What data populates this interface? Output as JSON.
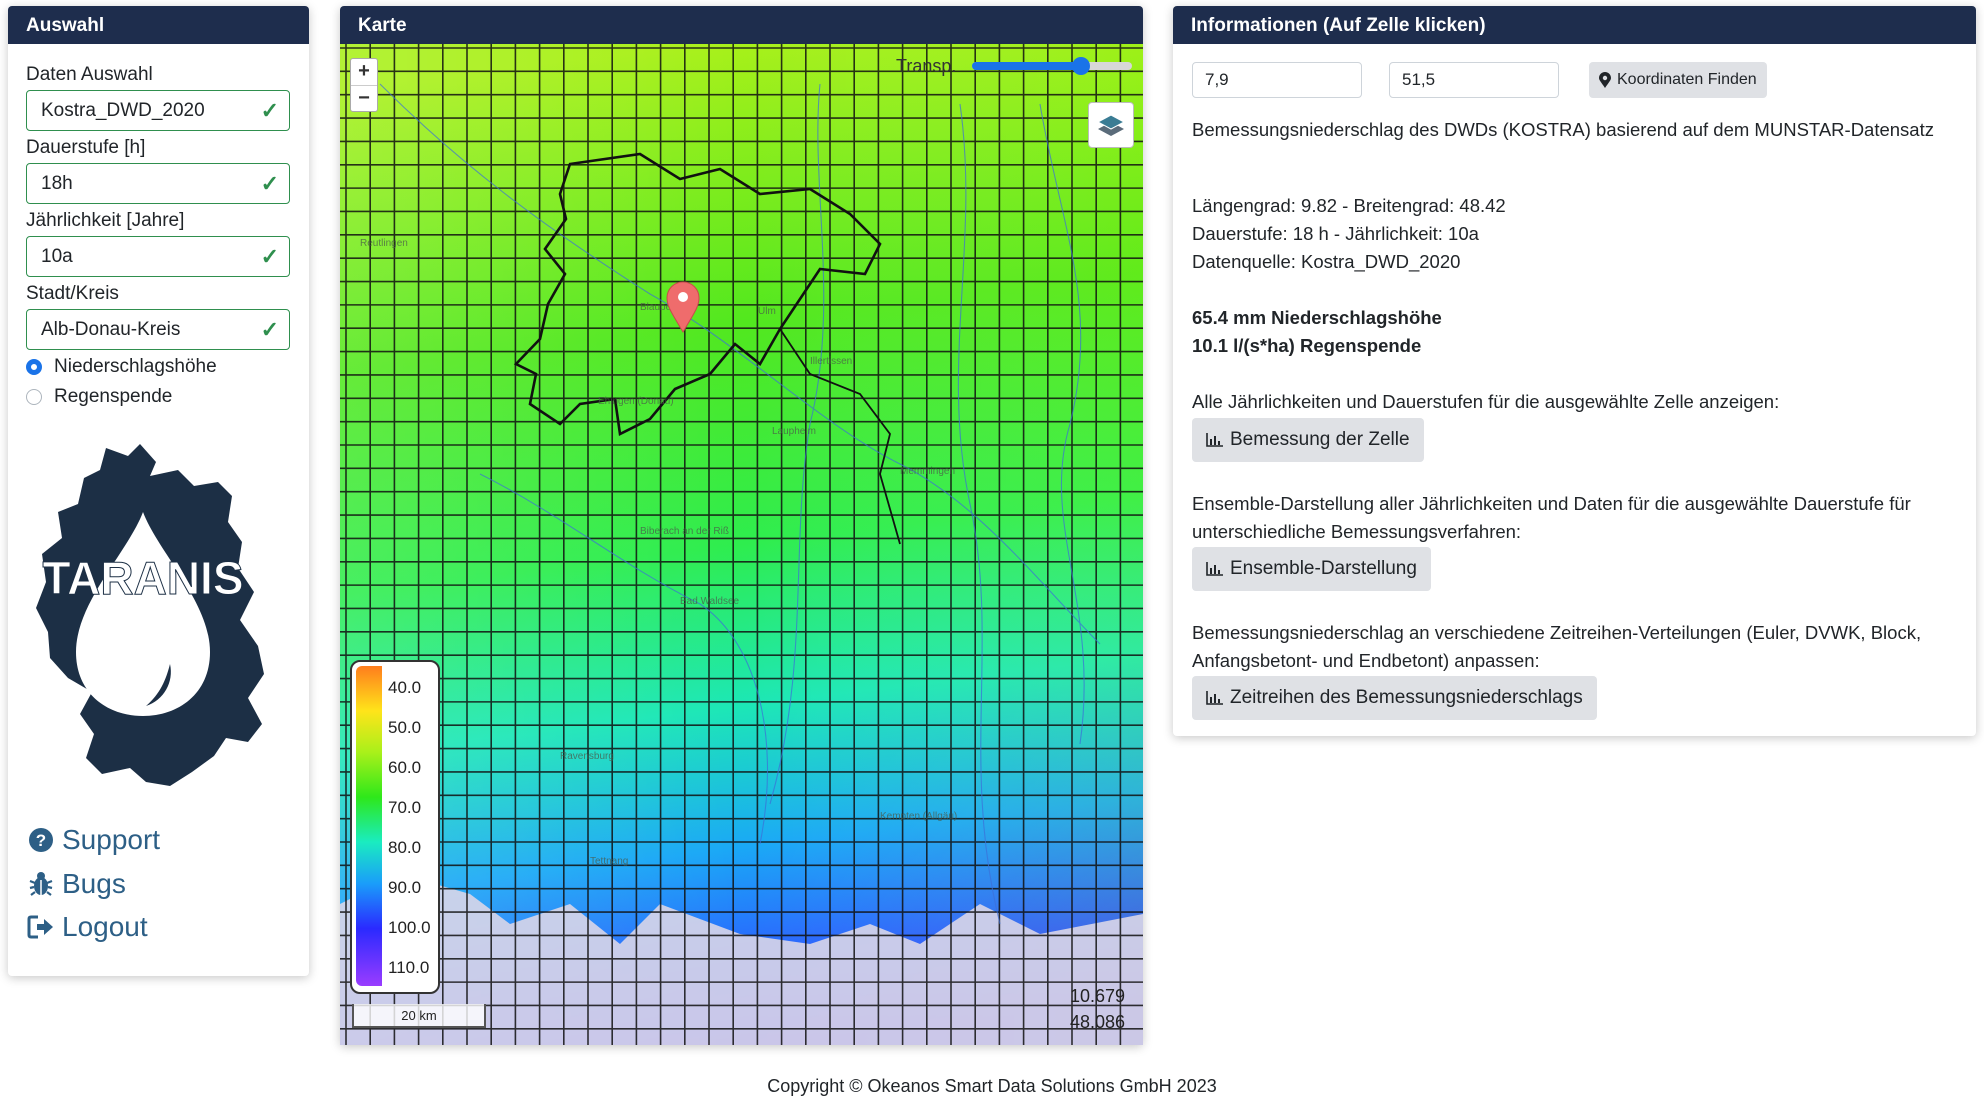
{
  "left_panel": {
    "title": "Auswahl",
    "fields": [
      {
        "label": "Daten Auswahl",
        "value": "Kostra_DWD_2020"
      },
      {
        "label": "Dauerstufe [h]",
        "value": "18h"
      },
      {
        "label": "Jährlichkeit [Jahre]",
        "value": "10a"
      },
      {
        "label": "Stadt/Kreis",
        "value": "Alb-Donau-Kreis"
      }
    ],
    "radio_options": [
      {
        "label": "Niederschlagshöhe",
        "selected": true
      },
      {
        "label": "Regenspende",
        "selected": false
      }
    ],
    "logo_text": "TARANIS",
    "links": [
      {
        "label": "Support",
        "icon": "question-circle-icon"
      },
      {
        "label": "Bugs",
        "icon": "bug-icon"
      },
      {
        "label": "Logout",
        "icon": "logout-icon"
      }
    ]
  },
  "map_panel": {
    "title": "Karte",
    "zoom_in": "+",
    "zoom_out": "−",
    "transparency_label": "Transp.",
    "transparency_value": 0.7,
    "legend": {
      "ticks": [
        "40.0",
        "50.0",
        "60.0",
        "70.0",
        "80.0",
        "90.0",
        "100.0",
        "110.0"
      ],
      "colors": [
        "#ff7d1d",
        "#ffe41a",
        "#a9f01a",
        "#2ee81a",
        "#1aecc0",
        "#1a9dfa",
        "#2a2aff",
        "#9a3cff"
      ]
    },
    "scale_label": "20 km",
    "cursor_lon": "10.679",
    "cursor_lat": "48.086",
    "map_place_labels": [
      "Reutlingen",
      "Ulm",
      "Ehingen (Donau)",
      "Blaubeuren",
      "Laupheim",
      "Biberach an der Riß",
      "Bad Waldsee",
      "Ravensburg",
      "Kempten (Allgäu)",
      "Memmingen",
      "Illertissen",
      "Tettnang"
    ]
  },
  "info_panel": {
    "title": "Informationen (Auf Zelle klicken)",
    "lon_input": "7,9",
    "lat_input": "51,5",
    "find_button": "Koordinaten Finden",
    "description": "Bemessungsniederschlag des DWDs (KOSTRA) basierend auf dem MUNSTAR-Datensatz",
    "line_coords": "Längengrad: 9.82 - Breitengrad: 48.42",
    "line_duration": "Dauerstufe: 18 h - Jährlichkeit: 10a",
    "line_source": "Datenquelle: Kostra_DWD_2020",
    "result_height": "65.4 mm Niederschlagshöhe",
    "result_rate": "10.1 l/(s*ha) Regenspende",
    "section1_text": "Alle Jährlichkeiten und Dauerstufen für die ausgewählte Zelle anzeigen:",
    "section1_button": "Bemessung der Zelle",
    "section2_text": "Ensemble-Darstellung aller Jährlichkeiten und Daten für die ausgewählte Dauerstufe für unterschiedliche Bemessungsverfahren:",
    "section2_button": "Ensemble-Darstellung",
    "section3_text": "Bemessungsniederschlag an verschiedene Zeitreihen-Verteilungen (Euler, DVWK, Block, Anfangsbetont- und Endbetont) anpassen:",
    "section3_button": "Zeitreihen des Bemessungsniederschlags"
  },
  "footer": "Copyright © Okeanos Smart Data Solutions GmbH 2023"
}
